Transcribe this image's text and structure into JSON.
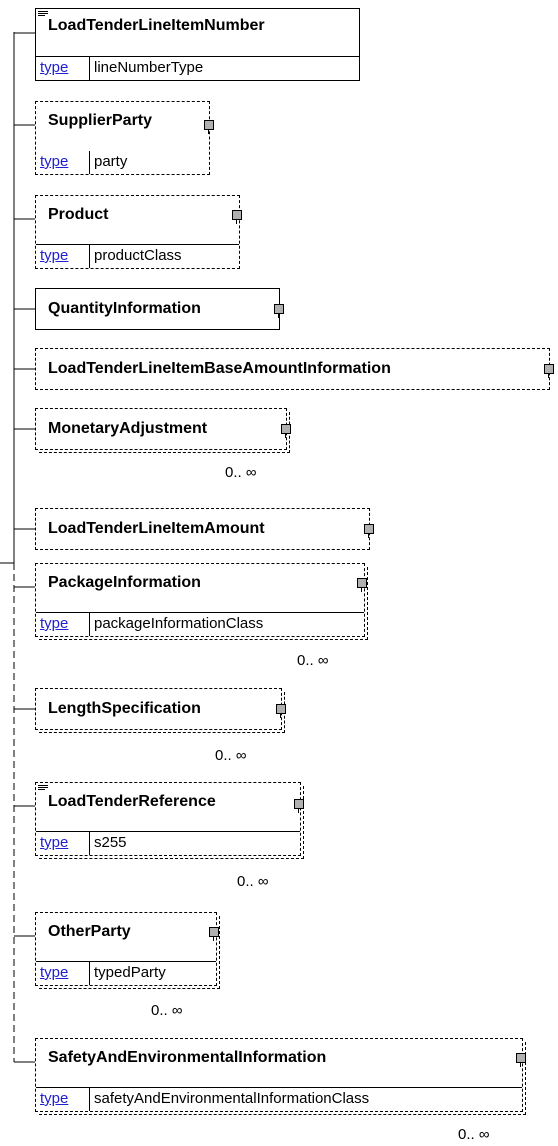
{
  "diagram": {
    "type_label": "type",
    "elements": [
      {
        "id": "LoadTenderLineItemNumber",
        "label": "LoadTenderLineItemNumber",
        "type": "lineNumberType",
        "optional": false,
        "repeat": false,
        "expandable": false,
        "documented": true
      },
      {
        "id": "SupplierParty",
        "label": "SupplierParty",
        "type": "party",
        "optional": true,
        "repeat": false,
        "expandable": true,
        "documented": false
      },
      {
        "id": "Product",
        "label": "Product",
        "type": "productClass",
        "optional": true,
        "repeat": false,
        "expandable": true,
        "documented": false
      },
      {
        "id": "QuantityInformation",
        "label": "QuantityInformation",
        "optional": false,
        "repeat": false,
        "expandable": true,
        "documented": false
      },
      {
        "id": "LoadTenderLineItemBaseAmountInformation",
        "label": "LoadTenderLineItemBaseAmountInformation",
        "optional": true,
        "repeat": false,
        "expandable": true,
        "documented": false
      },
      {
        "id": "MonetaryAdjustment",
        "label": "MonetaryAdjustment",
        "optional": true,
        "repeat": true,
        "cardinality": "0.. ∞",
        "expandable": true,
        "documented": false
      },
      {
        "id": "LoadTenderLineItemAmount",
        "label": "LoadTenderLineItemAmount",
        "optional": true,
        "repeat": false,
        "expandable": true,
        "documented": false
      },
      {
        "id": "PackageInformation",
        "label": "PackageInformation",
        "type": "packageInformationClass",
        "optional": true,
        "repeat": true,
        "cardinality": "0.. ∞",
        "expandable": true,
        "documented": false
      },
      {
        "id": "LengthSpecification",
        "label": "LengthSpecification",
        "optional": true,
        "repeat": true,
        "cardinality": "0.. ∞",
        "expandable": true,
        "documented": false
      },
      {
        "id": "LoadTenderReference",
        "label": "LoadTenderReference",
        "type": "s255",
        "optional": true,
        "repeat": true,
        "cardinality": "0.. ∞",
        "expandable": true,
        "documented": true
      },
      {
        "id": "OtherParty",
        "label": "OtherParty",
        "type": "typedParty",
        "optional": true,
        "repeat": true,
        "cardinality": "0.. ∞",
        "expandable": true,
        "documented": false
      },
      {
        "id": "SafetyAndEnvironmentalInformation",
        "label": "SafetyAndEnvironmentalInformation",
        "type": "safetyAndEnvironmentalInformationClass",
        "optional": true,
        "repeat": true,
        "cardinality": "0.. ∞",
        "expandable": true,
        "documented": false
      }
    ]
  }
}
